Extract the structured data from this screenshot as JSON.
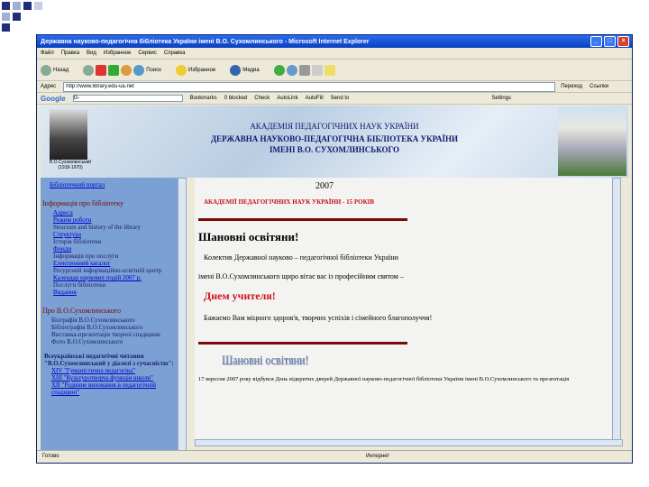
{
  "window": {
    "title": "Державна науково-педагогічна бібліотека України імені В.О. Сухомлинського - Microsoft Internet Explorer"
  },
  "menu": [
    "Файл",
    "Правка",
    "Вид",
    "Избранное",
    "Сервис",
    "Справка"
  ],
  "toolbar": {
    "back": "Назад",
    "search": "Поиск",
    "favorites": "Избранное",
    "media": "Медиа"
  },
  "address": {
    "label": "Адрес",
    "url": "http://www.library.edu-ua.net",
    "go": "Переход",
    "links": "Ссылки"
  },
  "google": {
    "logo": "Google",
    "input": "G-",
    "bookmarks": "Bookmarks",
    "blocked": "0 blocked",
    "check": "Check",
    "autolink": "AutoLink",
    "autofill": "AutoFill",
    "sendto": "Send to",
    "settings": "Settings"
  },
  "banner": {
    "line1": "АКАДЕМІЯ ПЕДАГОГІЧНИХ НАУК УКРАЇНИ",
    "line2": "ДЕРЖАВНА НАУКОВО-ПЕДАГОГІЧНА БІБЛІОТЕКА УКРАЇНИ",
    "line3": "ІМЕНІ В.О. СУХОМЛИНСЬКОГО",
    "portrait_caption": "В.О.Сухомлинський",
    "portrait_years": "(1918-1970)"
  },
  "sidebar": {
    "top_link": "Бібліотечний портал",
    "section1": "Інформація про бібліотеку",
    "items1": [
      "Адреса",
      "Режим роботи",
      "Structure and history of the library",
      "Структура",
      "Історія бібліотеки",
      "Фонди",
      "Інформація про послуги",
      "Електронний каталог",
      "Ресурсний інформаційно-освітній центр",
      "Календар наукових подій 2007 р.",
      "Послуги бібліотеки",
      "Видання"
    ],
    "section2": "Про В.О.Сухомлинського",
    "items2": [
      "Біографія В.О.Сухомлинського",
      "Бібліографія В.О.Сухомлинського",
      "Виставка-презентація творчої спадщини",
      "Фото В.О.Сухомлинського"
    ],
    "section3": "Всеукраїнські педагогічні читання \"В.О.Сухомлинський у діалозі з сучасністю\":",
    "items3": [
      "XIV \"Гуманістична педагогіка\"",
      "XIII \"Культуротворча функція школи\"",
      "XII \"Родинне виховання в педагогічній спадщині\""
    ]
  },
  "main": {
    "year": "2007",
    "academy": "АКАДЕМІЇ ПЕДАГОГІЧНИХ НАУК УКРАЇНИ - 15 РОКІВ",
    "greeting": "Шановні освітяни!",
    "p1": "Колектив Державної науково – педагогічної бібліотеки України",
    "p2": "імені В.О.Сухомлинського щиро вітає вас із професійним святом –",
    "holiday": "Днем учителя!",
    "wish": "Бажаємо Вам міцного здоров'я, творчих успіхів і сімейного благополуччя!",
    "greeting2": "Шановні освітяни!",
    "bottom": "17 вересня 2007 року відбувся День відкритих дверей Державної науково-педагогічної бібліотеки України імені В.О.Сухомлинського та презентація"
  },
  "status": {
    "left": "Готово",
    "zone": "Интернет"
  }
}
